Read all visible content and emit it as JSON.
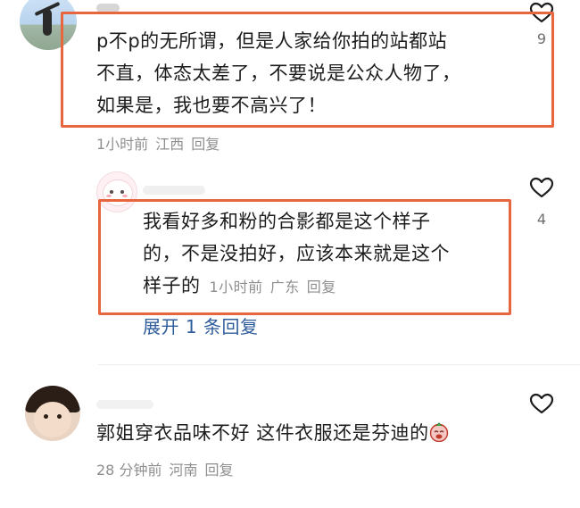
{
  "comments": [
    {
      "text_line1": "p不p的无所谓，但是人家给你拍的站都站",
      "text_line2": "不直，体态太差了，不要说是公众人物了，",
      "text_line3": "如果是，我也要不高兴了！",
      "time": "1小时前",
      "location": "江西",
      "reply_label": "回复",
      "likes": "9"
    },
    {
      "text_line1": "我看好多和粉的合影都是这个样子",
      "text_line2": "的，不是没拍好，应该本来就是这个",
      "text_line3": "样子的",
      "time": "1小时前",
      "location": "广东",
      "reply_label": "回复",
      "likes": "4",
      "expand_label": "展开 1 条回复"
    },
    {
      "text_line1": "郭姐穿衣品味不好 这件衣服还是芬迪的",
      "emoji": "face-emoji",
      "time": "28 分钟前",
      "location": "河南",
      "reply_label": "回复"
    }
  ],
  "colors": {
    "highlight": "#e8663e",
    "link": "#2f5d9c",
    "meta": "#8f8f8f"
  },
  "icons": [
    "heart-icon"
  ]
}
